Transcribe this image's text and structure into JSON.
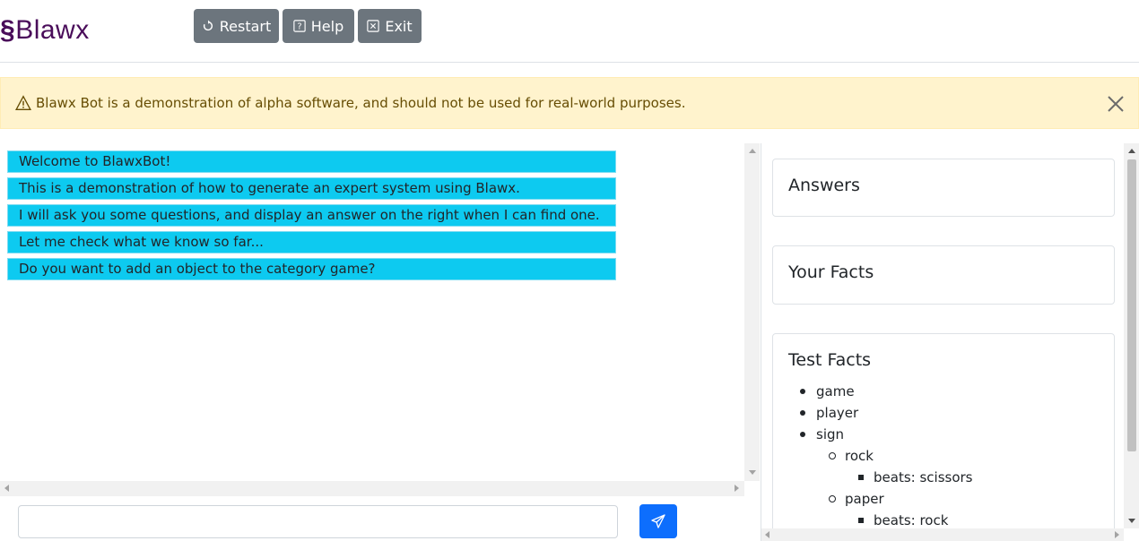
{
  "app": {
    "logo_symbol": "§",
    "logo_text": "Blawx"
  },
  "toolbar": {
    "restart_label": "Restart",
    "help_label": "Help",
    "exit_label": "Exit"
  },
  "alert": {
    "text": "Blawx Bot is a demonstration of alpha software, and should not be used for real-world purposes."
  },
  "chat": {
    "messages": [
      "Welcome to BlawxBot!",
      "This is a demonstration of how to generate an expert system using Blawx.",
      "I will ask you some questions, and display an answer on the right when I can find one.",
      "Let me check what we know so far...",
      "Do you want to add an object to the category game?"
    ],
    "input_value": ""
  },
  "panel": {
    "answers_title": "Answers",
    "your_facts_title": "Your Facts",
    "test_facts_title": "Test Facts",
    "test_facts": {
      "items": [
        "game",
        "player",
        "sign"
      ],
      "sign_children": [
        {
          "label": "rock",
          "detail": "beats: scissors"
        },
        {
          "label": "paper",
          "detail": "beats: rock"
        }
      ]
    }
  },
  "colors": {
    "logo": "#4a0d5a",
    "button": "#6c757d",
    "alert_bg": "#fff3cd",
    "message_bg": "#0dcaf0",
    "send_button": "#0d6efd"
  }
}
